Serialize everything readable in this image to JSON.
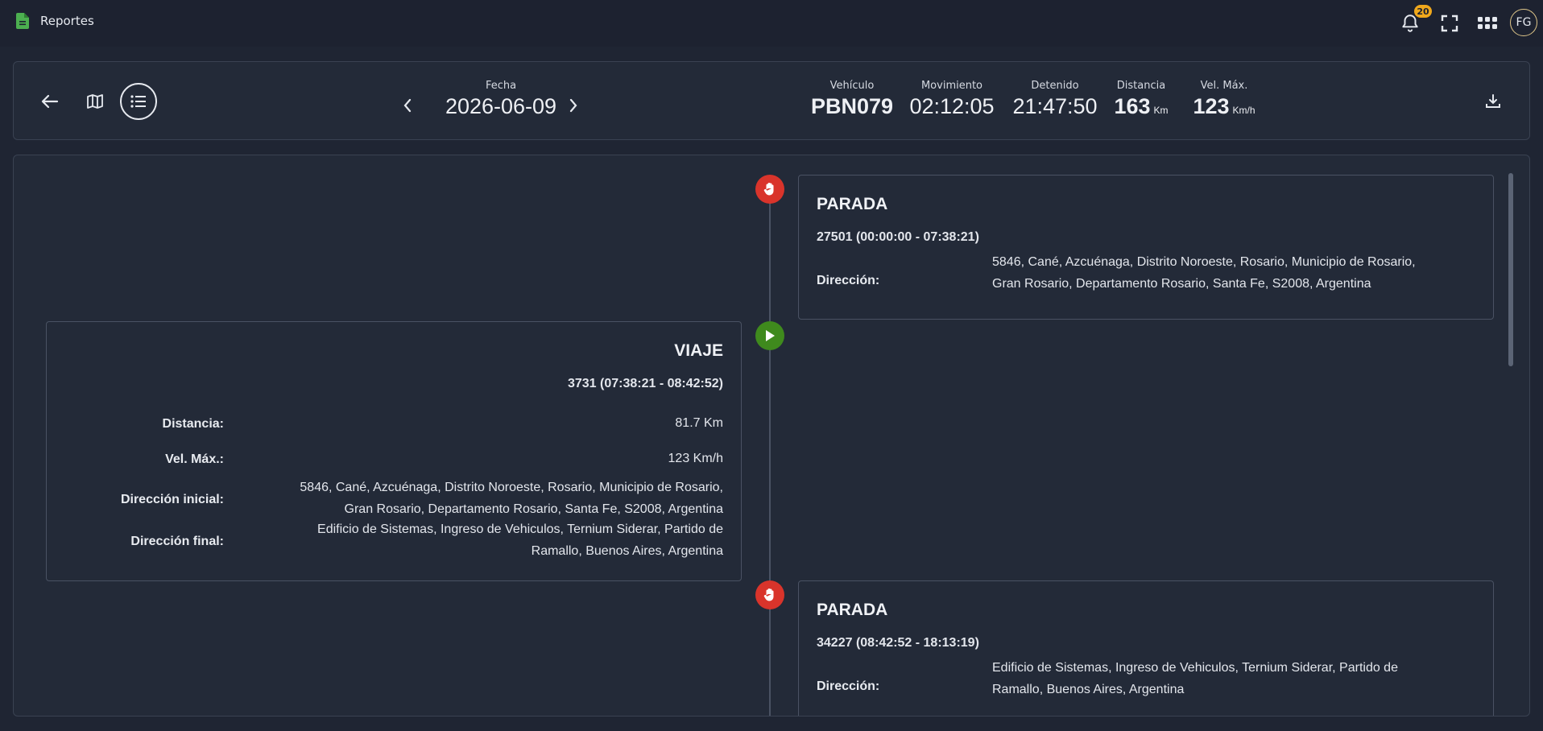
{
  "topbar": {
    "breadcrumb_label": "Reportes",
    "notifications_count": "20",
    "avatar_initials": "FG"
  },
  "header": {
    "date_label": "Fecha",
    "date_value": "2026-06-09",
    "stats": {
      "vehicle_label": "Vehículo",
      "vehicle_value": "PBN079",
      "movement_label": "Movimiento",
      "movement_value": "02:12:05",
      "stopped_label": "Detenido",
      "stopped_value": "21:47:50",
      "distance_label": "Distancia",
      "distance_value": "163",
      "distance_unit": "Km",
      "max_speed_label": "Vel. Máx.",
      "max_speed_value": "123",
      "max_speed_unit": "Km/h"
    }
  },
  "timeline": {
    "events": [
      {
        "type": "stop",
        "title": "PARADA",
        "subtitle": "27501 (00:00:00 - 07:38:21)",
        "address_label": "Dirección:",
        "address_line1": "5846, Cané, Azcuénaga, Distrito Noroeste, Rosario, Municipio de Rosario,",
        "address_line2": "Gran Rosario, Departamento Rosario, Santa Fe, S2008, Argentina"
      },
      {
        "type": "trip",
        "title": "VIAJE",
        "subtitle": "3731 (07:38:21 - 08:42:52)",
        "distance_label": "Distancia:",
        "distance_value": "81.7 Km",
        "max_speed_label": "Vel. Máx.:",
        "max_speed_value": "123 Km/h",
        "start_label": "Dirección inicial:",
        "start_line1": "5846, Cané, Azcuénaga, Distrito Noroeste, Rosario, Municipio de Rosario,",
        "start_line2": "Gran Rosario, Departamento Rosario, Santa Fe, S2008, Argentina",
        "end_label": "Dirección final:",
        "end_line1": "Edificio de Sistemas, Ingreso de Vehiculos, Ternium Siderar, Partido de",
        "end_line2": "Ramallo, Buenos Aires, Argentina"
      },
      {
        "type": "stop",
        "title": "PARADA",
        "subtitle": "34227 (08:42:52 - 18:13:19)",
        "address_label": "Dirección:",
        "address_line1": "Edificio de Sistemas, Ingreso de Vehiculos, Ternium Siderar, Partido de",
        "address_line2": "Ramallo, Buenos Aires, Argentina"
      }
    ]
  },
  "colors": {
    "background": "#1f2533",
    "card": "#232a38",
    "stop_marker": "#d9342b",
    "trip_marker": "#3f8a1d",
    "badge": "#f0a81c"
  },
  "icons": [
    "document-icon",
    "bell-icon",
    "fullscreen-icon",
    "apps-grid-icon",
    "back-arrow-icon",
    "map-icon",
    "list-icon",
    "chevron-left-icon",
    "chevron-right-icon",
    "download-icon",
    "hand-stop-icon",
    "play-icon"
  ]
}
